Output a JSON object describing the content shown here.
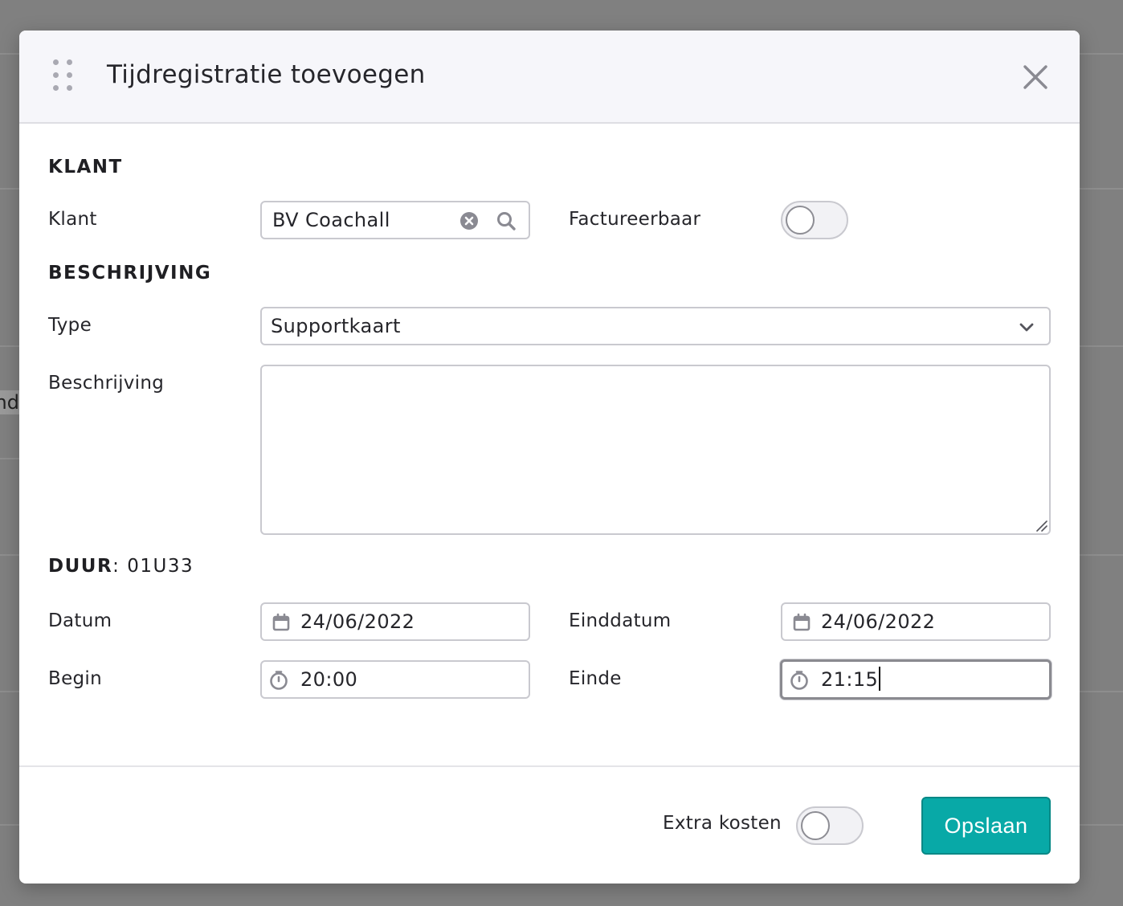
{
  "modal": {
    "title": "Tijdregistratie toevoegen"
  },
  "sections": {
    "klant_heading": "KLANT",
    "beschrijving_heading": "BESCHRIJVING"
  },
  "klant": {
    "label": "Klant",
    "value": "BV Coachall",
    "factureerbaar_label": "Factureerbaar",
    "factureerbaar_on": false
  },
  "beschrijving": {
    "type_label": "Type",
    "type_value": "Supportkaart",
    "description_label": "Beschrijving",
    "description_value": ""
  },
  "duur": {
    "label": "DUUR",
    "value": ": 01U33"
  },
  "tijd": {
    "datum_label": "Datum",
    "datum_value": "24/06/2022",
    "einddatum_label": "Einddatum",
    "einddatum_value": "24/06/2022",
    "begin_label": "Begin",
    "begin_value": "20:00",
    "einde_label": "Einde",
    "einde_value": "21:15"
  },
  "footer": {
    "extra_kosten_label": "Extra kosten",
    "extra_kosten_on": false,
    "save_label": "Opslaan"
  },
  "colors": {
    "primary": "#08a9a7",
    "header_bg": "#f6f6fa",
    "backdrop": "#808080"
  },
  "backdrop_fragment": "nd"
}
